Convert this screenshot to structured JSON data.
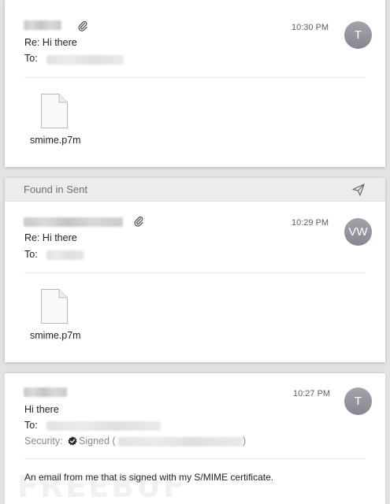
{
  "messages": [
    {
      "time": "10:30 PM",
      "avatar_initials": "T",
      "subject": "Re: Hi there",
      "to_label": "To:",
      "attachment_name": "smime.p7m"
    },
    {
      "banner_label": "Found in Sent",
      "time": "10:29 PM",
      "avatar_initials": "VW",
      "subject": "Re: Hi there",
      "to_label": "To:",
      "attachment_name": "smime.p7m"
    },
    {
      "time": "10:27 PM",
      "avatar_initials": "T",
      "subject": "Hi there",
      "to_label": "To:",
      "security_label": "Security:",
      "security_status": "Signed (",
      "security_close": ")",
      "body": "An email from me that is signed with my S/MIME certificate."
    }
  ],
  "watermark": "FREEBUF",
  "icons": {
    "attachment": "paperclip-icon",
    "file": "document-icon",
    "sent": "paper-plane-icon",
    "signed": "check-badge-icon"
  },
  "colors": {
    "avatar": "#8e8f97",
    "background": "#e4e3e3",
    "banner": "#ececec"
  }
}
